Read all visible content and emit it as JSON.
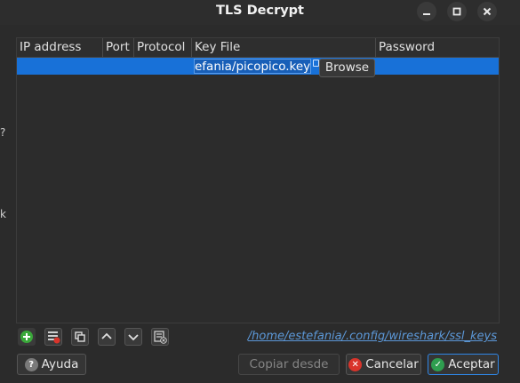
{
  "window": {
    "title": "TLS Decrypt"
  },
  "left_edge": {
    "frag1": "?",
    "frag2": "k"
  },
  "table": {
    "columns": [
      "IP address",
      "Port",
      "Protocol",
      "Key File",
      "Password"
    ],
    "rows": [
      {
        "ip": "",
        "port": "",
        "protocol": "",
        "key_file": "efania/picopico.key",
        "password": ""
      }
    ],
    "browse_label": "Browse"
  },
  "toolbar": {
    "icons": [
      "add-icon",
      "remove-icon",
      "copy-icon",
      "move-up-icon",
      "move-down-icon",
      "clear-icon"
    ],
    "path_link": "/home/estefania/.config/wireshark/ssl_keys"
  },
  "buttons": {
    "help": "Ayuda",
    "copy_from": "Copiar desde",
    "cancel": "Cancelar",
    "ok": "Aceptar"
  },
  "colors": {
    "selection": "#1871d8",
    "link": "#5c98d8",
    "add_green": "#3aa83a",
    "cancel_red": "#d9342b",
    "ok_green": "#2e9e4f"
  }
}
